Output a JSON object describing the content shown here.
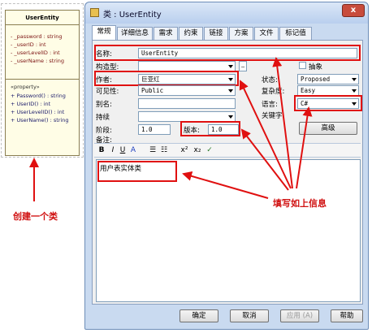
{
  "uml_class": {
    "name": "UserEntity",
    "attributes": [
      "-  _password : string",
      "-  _userID : int",
      "-  _userLevelID : int",
      "-  _userName : string"
    ],
    "stereotype": "«property»",
    "operations": [
      "+  Password() : string",
      "+  UserID() : int",
      "+  UserLevelID() : int",
      "+  UserName() : string"
    ]
  },
  "annotations": {
    "create_class": "创建一个类",
    "fill_info": "填写如上信息"
  },
  "dialog": {
    "title": "类 : UserEntity",
    "close": "x",
    "tabs": [
      "常规",
      "详细信息",
      "需求",
      "约束",
      "链接",
      "方案",
      "文件",
      "标记值"
    ],
    "labels": {
      "name": "名称:",
      "stereotype": "构造型:",
      "abstract": "抽象",
      "author": "作者:",
      "status": "状态:",
      "visibility": "可见性:",
      "complexity": "复杂度:",
      "alias": "别名:",
      "language": "语言:",
      "persistence": "持续",
      "keywords": "关键字",
      "phase": "阶段:",
      "version": "版本:",
      "notes": "备注:"
    },
    "values": {
      "name": "UserEntity",
      "stereotype": "",
      "author": "巨亚红",
      "status": "Proposed",
      "visibility": "Public",
      "complexity": "Easy",
      "alias": "",
      "language": "C#",
      "persistence": "",
      "keywords": "",
      "phase": "1.0",
      "version": "1.0",
      "notes": "用户表实体类"
    },
    "advanced_button": "高级",
    "toolbar": {
      "bold": "B",
      "italic": "I",
      "underline": "U",
      "font_color": "A",
      "bullets": "☰",
      "numbering": "☷",
      "superscript": "x²",
      "subscript": "x₂",
      "spellcheck": "✓"
    },
    "buttons": {
      "ok": "确定",
      "cancel": "取消",
      "apply": "应用 (A)",
      "help": "帮助"
    }
  }
}
